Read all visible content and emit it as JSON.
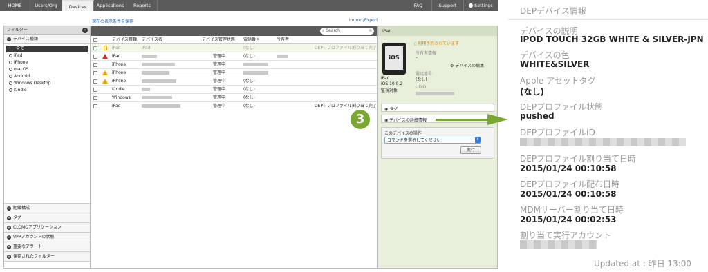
{
  "nav": {
    "tabs": [
      {
        "label": "HOME"
      },
      {
        "label": "Users/Org"
      },
      {
        "label": "Devices"
      },
      {
        "label": "Applications"
      },
      {
        "label": "Reports"
      }
    ],
    "right": {
      "faq": "FAQ",
      "support": "Support",
      "settings": "Settings"
    }
  },
  "toolbar": {
    "save_filter": "現在の表示条件を保存",
    "import_export": "Import/Export"
  },
  "filter_panel": {
    "title": "フィルター",
    "device_type_section": "デバイス種類",
    "items": [
      {
        "label": "全て"
      },
      {
        "label": "iPad"
      },
      {
        "label": "iPhone"
      },
      {
        "label": "macOS"
      },
      {
        "label": "Android"
      },
      {
        "label": "Windows Desktop"
      },
      {
        "label": "Kindle"
      }
    ],
    "bottom_sections": [
      {
        "label": "組織構成"
      },
      {
        "label": "タグ"
      },
      {
        "label": "CLOMOアプリケーション"
      },
      {
        "label": "VPPアカウントの状態"
      },
      {
        "label": "重要なアラート"
      },
      {
        "label": "保存されたフィルター"
      }
    ]
  },
  "search": {
    "placeholder": "Search"
  },
  "table": {
    "headers": {
      "type": "デバイス種類",
      "name": "デバイス名",
      "status": "デバイス管理状態",
      "phone": "電話番号",
      "owner": "所有者"
    },
    "rows": [
      {
        "type": "iPad",
        "name": "iPad",
        "status": "–",
        "phone": "(なし)",
        "extra": "DEP : プロファイル割り当て完了"
      },
      {
        "type": "iPad",
        "status": "管理中",
        "phone": "(なし)",
        "extra": ""
      },
      {
        "type": "iPhone",
        "status": "管理中",
        "phone": "",
        "extra": ""
      },
      {
        "type": "iPhone",
        "status": "管理中",
        "phone": "",
        "extra": ""
      },
      {
        "type": "iPhone",
        "status": "管理中",
        "phone": "(なし)",
        "extra": ""
      },
      {
        "type": "Kindle",
        "status": "管理中",
        "phone": "(なし)",
        "extra": ""
      },
      {
        "type": "Windows",
        "status": "管理中",
        "phone": "(なし)",
        "extra": ""
      },
      {
        "type": "iPad",
        "status": "管理中",
        "phone": "(なし)",
        "extra": "DEP : プロファイル割り当て完了"
      }
    ]
  },
  "detail": {
    "header": "iPad",
    "reserved": "利用予約されています",
    "owner_label": "所有者情報",
    "owner_value": "–",
    "edit_link": "デバイスの編集",
    "screen_text": "iOS",
    "model": "iPad",
    "os": "iOS 10.0.2",
    "supervised": "監視対象",
    "phone_label": "電話番号",
    "phone_value": "(なし)",
    "udid_label": "UDID",
    "tag_section": "タグ",
    "details_section": "デバイスの詳細情報",
    "ops_title": "このデバイスの操作",
    "command_placeholder": "コマンドを選択してください",
    "run_button": "実行"
  },
  "callout": {
    "number": "3",
    "accent": "#78a832"
  },
  "zoom": {
    "section_title": "DEPデバイス情報",
    "fields": [
      {
        "label": "デバイスの説明",
        "value": "IPOD TOUCH 32GB WHITE & SILVER-JPN"
      },
      {
        "label": "デバイスの色",
        "value": "WHITE&SILVER"
      },
      {
        "label": "Apple アセットタグ",
        "value": "(なし)"
      },
      {
        "label": "DEPプロファイル状態",
        "value": "pushed"
      },
      {
        "label": "DEPプロファイルID",
        "value": ""
      },
      {
        "label": "DEPプロファイル割り当て日時",
        "value": "2015/01/24 00:10:58"
      },
      {
        "label": "DEPプロファイル配布日時",
        "value": "2015/01/24 00:10:58"
      },
      {
        "label": "MDMサーバー割り当て日時",
        "value": "2015/01/24 00:02:53"
      },
      {
        "label": "割り当て実行アカウント",
        "value": ""
      }
    ],
    "updated": "Updated at : 昨日 13:00"
  }
}
